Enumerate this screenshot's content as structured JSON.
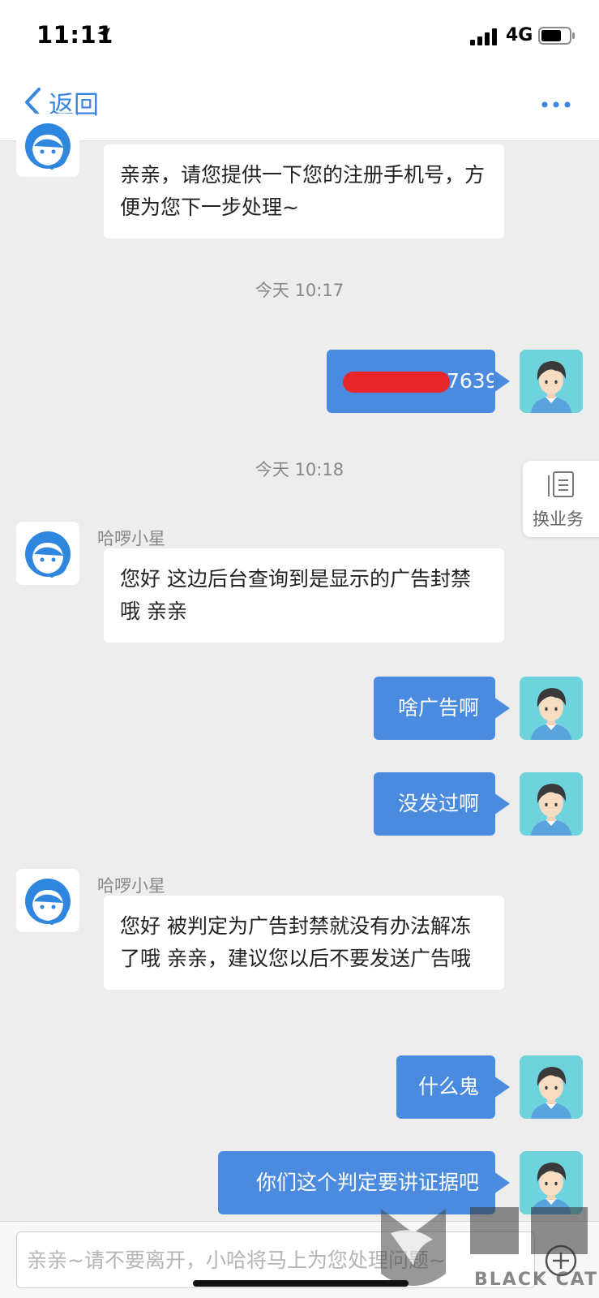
{
  "status_bar": {
    "time": "11:11",
    "network": "4G"
  },
  "nav": {
    "back_label": "返回"
  },
  "side_button": {
    "label": "换业务"
  },
  "messages": {
    "m1": {
      "text": "亲亲，请您提供一下您的注册手机号，方便为您下一步处理~"
    },
    "ts1": "今天 10:17",
    "m2": {
      "text_visible_suffix": "7639"
    },
    "ts2": "今天 10:18",
    "m3": {
      "sender": "哈啰小星",
      "text": "您好 这边后台查询到是显示的广告封禁哦 亲亲"
    },
    "m4": {
      "text": "啥广告啊"
    },
    "m5": {
      "text": "没发过啊"
    },
    "m6": {
      "sender": "哈啰小星",
      "text": "您好 被判定为广告封禁就没有办法解冻了哦 亲亲，建议您以后不要发送广告哦"
    },
    "m7": {
      "text": "什么鬼"
    },
    "m8": {
      "text": "你们这个判定要讲证据吧"
    }
  },
  "input": {
    "placeholder": "亲亲~请不要离开，小哈将马上为您处理问题~"
  },
  "watermark": {
    "text": "BLACK CAT"
  },
  "colors": {
    "accent": "#3a86e0",
    "bubble_out": "#4a8be0",
    "redaction": "#e8252b"
  }
}
